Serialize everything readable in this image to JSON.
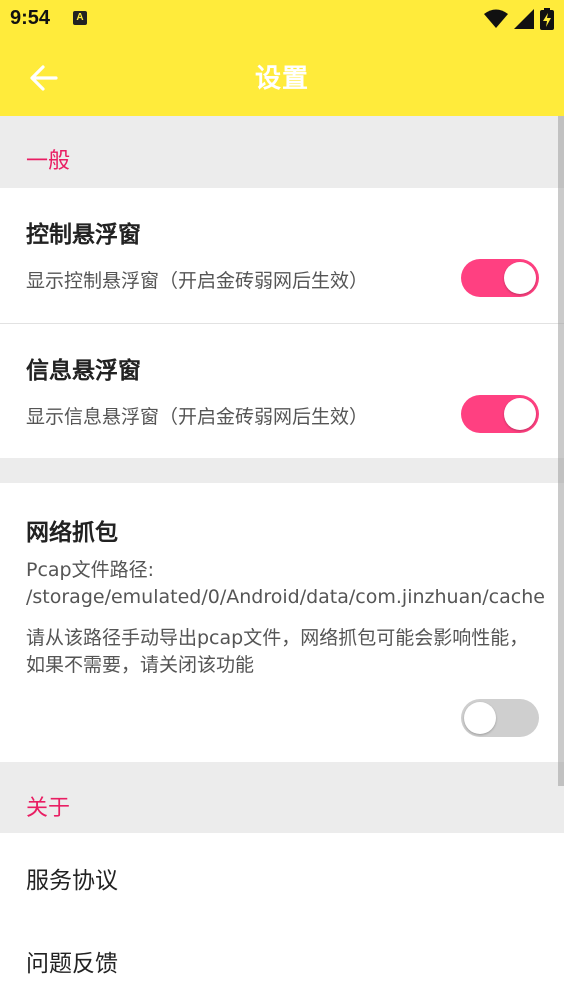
{
  "status_bar": {
    "time": "9:54",
    "notification_icon": "A",
    "icons": [
      "wifi-icon",
      "signal-icon",
      "battery-charging-icon"
    ]
  },
  "app_bar": {
    "back_icon": "arrow-left-icon",
    "title": "设置"
  },
  "sections": {
    "general": {
      "header": "一般"
    },
    "about": {
      "header": "关于"
    }
  },
  "settings": {
    "control_float": {
      "title": "控制悬浮窗",
      "subtitle": "显示控制悬浮窗（开启金砖弱网后生效）",
      "enabled": true
    },
    "info_float": {
      "title": "信息悬浮窗",
      "subtitle": "显示信息悬浮窗（开启金砖弱网后生效）",
      "enabled": true
    },
    "packet_capture": {
      "title": "网络抓包",
      "path_text": "Pcap文件路径: /storage/emulated/0/Android/data/com.jinzhuan/cache",
      "note": "请从该路径手动导出pcap文件，网络抓包可能会影响性能，如果不需要，请关闭该功能",
      "enabled": false
    }
  },
  "about_items": {
    "terms": "服务协议",
    "feedback": "问题反馈"
  },
  "colors": {
    "app_bar": "#ffeb3b",
    "accent": "#ff4081",
    "section_header_text": "#e91e63"
  }
}
